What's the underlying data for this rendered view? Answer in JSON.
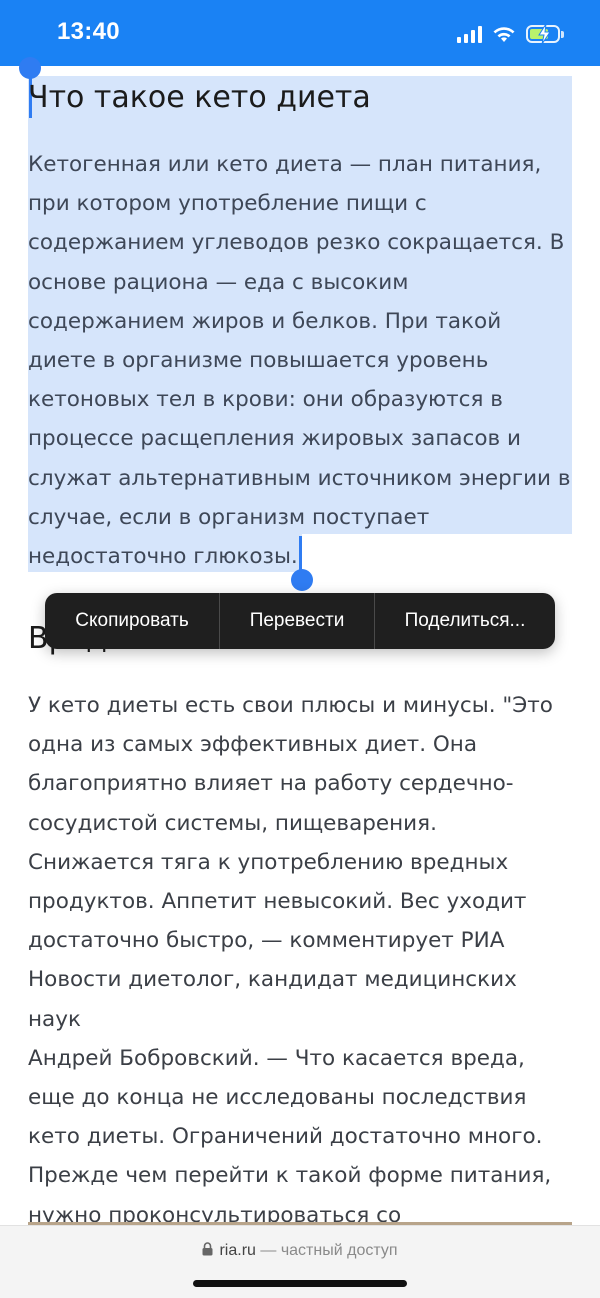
{
  "status_bar": {
    "time": "13:40",
    "icons": [
      "signal-icon",
      "wifi-icon",
      "battery-charging-icon"
    ],
    "background": "#1a82f4"
  },
  "article": {
    "heading_1": "Что такое кето диета",
    "paragraph_1_lines": [
      "Кетогенная или кето диета — план питания,",
      "при котором употребление пищи с",
      "содержанием углеводов резко сокращается. В",
      "основе рациона — еда с высоким",
      "содержанием жиров и белков. При такой",
      "диете в организме повышается уровень",
      "кетоновых тел в крови: они образуются в",
      "процессе расщепления жировых запасов и",
      "служат альтернативным источником энергии в",
      "случае, если в организм поступает",
      "недостаточно глюкозы."
    ],
    "heading_2": "Вред и польза",
    "paragraph_2_lines": [
      "У кето диеты есть свои плюсы и минусы. \"Это",
      "одна из самых эффективных диет. Она",
      "благоприятно влияет на работу сердечно-",
      "сосудистой системы, пищеварения.",
      "Снижается тяга к употреблению вредных",
      "продуктов. Аппетит невысокий. Вес уходит",
      "достаточно быстро, — комментирует РИА",
      "Новости диетолог, кандидат медицинских наук",
      "Андрей Бобровский. — Что касается вреда,",
      "еще до конца не исследованы последствия",
      "кето диеты. Ограничений достаточно много.",
      "Прежде чем перейти к такой форме питания,",
      "нужно проконсультироваться со специалистом\"."
    ],
    "selection_color": "#d6e5fb",
    "handle_color": "#2f7cf2"
  },
  "context_menu": {
    "items": [
      "Скопировать",
      "Перевести",
      "Поделиться..."
    ]
  },
  "bottom_bar": {
    "domain": "ria.ru",
    "suffix": "— частный доступ"
  }
}
